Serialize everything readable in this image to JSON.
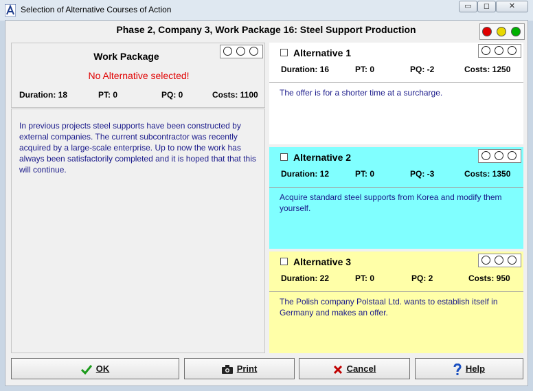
{
  "window": {
    "title": "Selection of Alternative Courses of Action",
    "controls": {
      "minimize": "▭",
      "maximize": "◻",
      "close": "✕"
    }
  },
  "header": {
    "title": "Phase 2, Company 3, Work Package 16: Steel Support Production",
    "traffic_lights": [
      "#e00000",
      "#e8d800",
      "#00b000"
    ]
  },
  "work_package": {
    "title": "Work Package",
    "status": "No Alternative selected!",
    "duration": "Duration: 18",
    "pt": "PT: 0",
    "pq": "PQ: 0",
    "costs": "Costs: 1100",
    "description": "In previous projects steel supports have been constructed by external companies. The current subcontractor was recently acquired by a large-scale enterprise. Up to now the work has always been satisfactorily completed and it is hoped that that this will continue."
  },
  "alternatives": [
    {
      "name": "Alternative 1",
      "duration": "Duration: 16",
      "pt": "PT: 0",
      "pq": "PQ: -2",
      "costs": "Costs: 1250",
      "description": "The offer is for a shorter time at a surcharge.",
      "color": "#ffffff"
    },
    {
      "name": "Alternative 2",
      "duration": "Duration: 12",
      "pt": "PT: 0",
      "pq": "PQ: -3",
      "costs": "Costs: 1350",
      "description": "Acquire standard steel supports from Korea and modify them yourself.",
      "color": "#80ffff"
    },
    {
      "name": "Alternative 3",
      "duration": "Duration: 22",
      "pt": "PT: 0",
      "pq": "PQ: 2",
      "costs": "Costs: 950",
      "description": "The Polish company Polstaal Ltd. wants to establish itself in Germany and makes an offer.",
      "color": "#ffffa8"
    }
  ],
  "buttons": {
    "ok": "OK",
    "print": "Print",
    "cancel": "Cancel",
    "help": "Help"
  }
}
